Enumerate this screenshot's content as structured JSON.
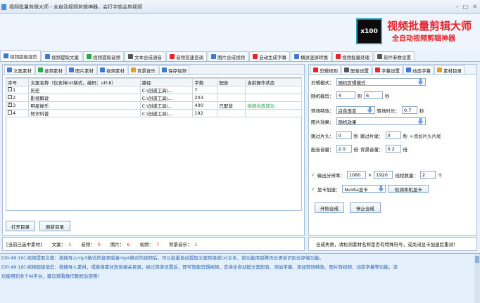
{
  "window": {
    "title": "视频批量剪辑大师 - 全自动视频剪辑神器，会打字就会剪视频",
    "controls": [
      "–",
      "□",
      "✕"
    ]
  },
  "banner": {
    "badge": "x100",
    "title": "视频批量剪辑大师",
    "subtitle": "全自动视频剪辑神器"
  },
  "main_tabs": [
    {
      "label": "视频超级混剪",
      "icon": "scissors-icon",
      "color": "#3a7ad6"
    },
    {
      "label": "视频提取文案",
      "icon": "document-icon",
      "color": "#3a7ad6"
    },
    {
      "label": "视频提取音频",
      "icon": "audio-icon",
      "color": "#2aa84a"
    },
    {
      "label": "文本合成语音",
      "icon": "microphone-icon",
      "color": "#555555"
    },
    {
      "label": "音频变速变调",
      "icon": "gauge-icon",
      "color": "#e8232a"
    },
    {
      "label": "图片合成视频",
      "icon": "image-icon",
      "color": "#3a7ad6"
    },
    {
      "label": "自动生成字幕",
      "icon": "text-icon",
      "color": "#e8232a"
    },
    {
      "label": "横屏竖屏转换",
      "icon": "screen-icon",
      "color": "#3a7ad6"
    },
    {
      "label": "视频批量处理",
      "icon": "film-icon",
      "color": "#e8232a"
    },
    {
      "label": "软件参数设置",
      "icon": "gear-icon",
      "color": "#555555"
    }
  ],
  "left_tabs": [
    {
      "label": "文案素材",
      "icon": "document-icon",
      "color": "#3a7ad6"
    },
    {
      "label": "音频素材",
      "icon": "audio-icon",
      "color": "#2aa84a"
    },
    {
      "label": "图片素材",
      "icon": "image-icon",
      "color": "#3a7ad6"
    },
    {
      "label": "视频素材",
      "icon": "play-icon",
      "color": "#3a7ad6"
    },
    {
      "label": "背景音乐",
      "icon": "music-icon",
      "color": "#e0a020"
    },
    {
      "label": "保存视频",
      "icon": "save-icon",
      "color": "#3a7ad6"
    }
  ],
  "table": {
    "headers": [
      "序号",
      "文案名称（仅支持txt格式，编码：utf-8）",
      "路径",
      "字数",
      "配音",
      "当前操作状态"
    ],
    "rows": [
      {
        "checked": false,
        "index": "1",
        "name": "历史",
        "path": "C:\\创道工具\\...",
        "count": "7",
        "dub": "",
        "status": ""
      },
      {
        "checked": false,
        "index": "2",
        "name": "影视解说",
        "path": "C:\\创道工具\\...",
        "count": "203",
        "dub": "",
        "status": ""
      },
      {
        "checked": true,
        "index": "3",
        "name": "明星娱乐",
        "path": "C:\\创道工具\\...",
        "count": "400",
        "dub": "已配音",
        "status": "视频合成成功"
      },
      {
        "checked": false,
        "index": "4",
        "name": "知识科普",
        "path": "C:\\创道工具\\...",
        "count": "192",
        "dub": "",
        "status": ""
      }
    ]
  },
  "left_buttons": {
    "open_dir": "打开目录",
    "refresh_dir": "刷新目录"
  },
  "right_tabs": [
    {
      "label": "剪辑规则",
      "icon": "film-icon",
      "color": "#e8232a"
    },
    {
      "label": "配音设置",
      "icon": "microphone-icon",
      "color": "#555555"
    },
    {
      "label": "字幕设置",
      "icon": "text-icon",
      "color": "#e8232a"
    },
    {
      "label": "动态字幕",
      "icon": "text-box-icon",
      "color": "#3a7ad6"
    },
    {
      "label": "素材目录",
      "icon": "folder-icon",
      "color": "#e0a020"
    }
  ],
  "settings": {
    "mode_label": "剪辑模式：",
    "mode_value": "随机剪辑模式",
    "duration_label": "随机截剪：",
    "duration_min": "4",
    "duration_to": "到",
    "duration_max": "6",
    "duration_unit": "秒",
    "transition_label": "转场特效：",
    "transition_value": "白色渐变",
    "transition_time_label": "转场时长：",
    "transition_time": "0.7",
    "transition_time_unit": "秒",
    "image_effect_label": "图片效果：",
    "image_effect_value": "随机效果",
    "skip_head_label": "跳过片头：",
    "skip_head": "0",
    "skip_head_unit": "秒",
    "skip_tail_label": "跳过片尾：",
    "skip_tail": "0",
    "skip_tail_unit": "秒",
    "add_head_tail": "×添加片头片尾",
    "dub_volume_label": "配音音量：",
    "dub_volume": "2.0",
    "dub_volume_unit": "倍",
    "bgm_volume_label": "背景音量：",
    "bgm_volume": "0.2",
    "bgm_volume_unit": "倍",
    "resolution_label": "输出分辨率：",
    "res_w": "1080",
    "res_x": "×",
    "res_h": "1920",
    "threads_label": "线程数量：",
    "threads": "2",
    "threads_unit": "个",
    "gpu_label": "显卡加速：",
    "gpu_value": "Nvidia显卡",
    "gpu_detect": "检测本机显卡",
    "start": "开始合成",
    "stop": "停止合成"
  },
  "status_left": {
    "prefix": "[当前已选中素材]",
    "text_label": "文案：",
    "text_count": "1",
    "audio_label": "音频：",
    "audio_count": "0",
    "image_label": "图片：",
    "image_count": "6",
    "video_label": "视频：",
    "video_count": "7",
    "bgm_label": "背景音乐：",
    "bgm_count": "1"
  },
  "status_right": "合成失败，请检测素材名称是否有特殊符号，或关闭显卡加速后重试！",
  "log": [
    "[00:48:16] 视频提取文案：拖拽导入mp3格式的音频或者mp4格式的视频后，可以批量自动提取文案转换成txt文本，该功能用到腾讯云语音识别云存储功能。",
    "[00:48:18] 视频超级混剪：拖拽导入素材，或者将素材放到相关目录，经过简单设置后，即可智能剪辑视频，支持全自动配文案配音、添加字幕、添加转场特效、图片转视频、动态字幕等功能，该",
    "功能用到多个AI平台，建议观看操作教程后使用！"
  ]
}
